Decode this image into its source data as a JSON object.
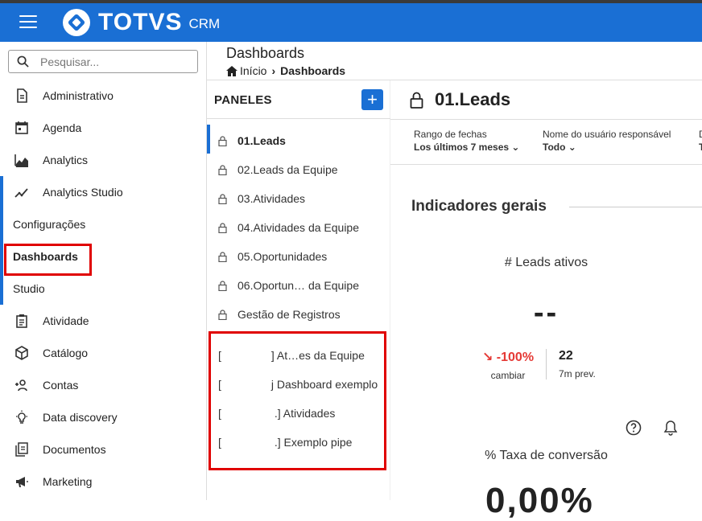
{
  "app": {
    "brand": "TOTVS",
    "product": "CRM"
  },
  "search": {
    "placeholder": "Pesquisar..."
  },
  "sidebar": {
    "items": [
      {
        "label": "Administrativo"
      },
      {
        "label": "Agenda"
      },
      {
        "label": "Analytics"
      },
      {
        "label": "Analytics Studio"
      }
    ],
    "subitems": [
      {
        "label": "Configurações"
      },
      {
        "label": "Dashboards"
      },
      {
        "label": "Studio"
      }
    ],
    "items2": [
      {
        "label": "Atividade"
      },
      {
        "label": "Catálogo"
      },
      {
        "label": "Contas"
      },
      {
        "label": "Data discovery"
      },
      {
        "label": "Documentos"
      },
      {
        "label": "Marketing"
      }
    ]
  },
  "header": {
    "title": "Dashboards",
    "breadcrumb": {
      "home": "Início",
      "current": "Dashboards"
    }
  },
  "panel": {
    "title": "PANELES",
    "add_label": "+",
    "items": [
      {
        "label": "01.Leads"
      },
      {
        "label": "02.Leads da Equipe"
      },
      {
        "label": "03.Atividades"
      },
      {
        "label": "04.Atividades da Equipe"
      },
      {
        "label": "05.Oportunidades"
      },
      {
        "label": "06.Oportun… da Equipe"
      },
      {
        "label": "Gestão de Registros"
      }
    ],
    "shared_items": [
      {
        "prefix": "[",
        "label": "] At…es da Equipe"
      },
      {
        "prefix": "[",
        "label": "j Dashboard exemplo"
      },
      {
        "prefix": "[",
        "label": ".] Atividades"
      },
      {
        "prefix": "[",
        "label": ".] Exemplo pipe"
      }
    ]
  },
  "dashboard": {
    "title": "01.Leads",
    "filters": [
      {
        "label": "Rango de fechas",
        "value": "Los últimos 7 meses"
      },
      {
        "label": "Nome do usuário responsável",
        "value": "Todo"
      },
      {
        "label": "D",
        "value": "T"
      }
    ],
    "section_title": "Indicadores gerais",
    "kpi1": {
      "title": "# Leads ativos",
      "value": "--",
      "change_value": "-100%",
      "change_label": "cambiar",
      "prev_value": "22",
      "prev_label": "7m prev."
    },
    "kpi2": {
      "title": "% Taxa de conversão",
      "value": "0,00%"
    }
  },
  "colors": {
    "brand": "#1a6fd4",
    "negative": "#e53935",
    "highlight": "#e00000"
  }
}
